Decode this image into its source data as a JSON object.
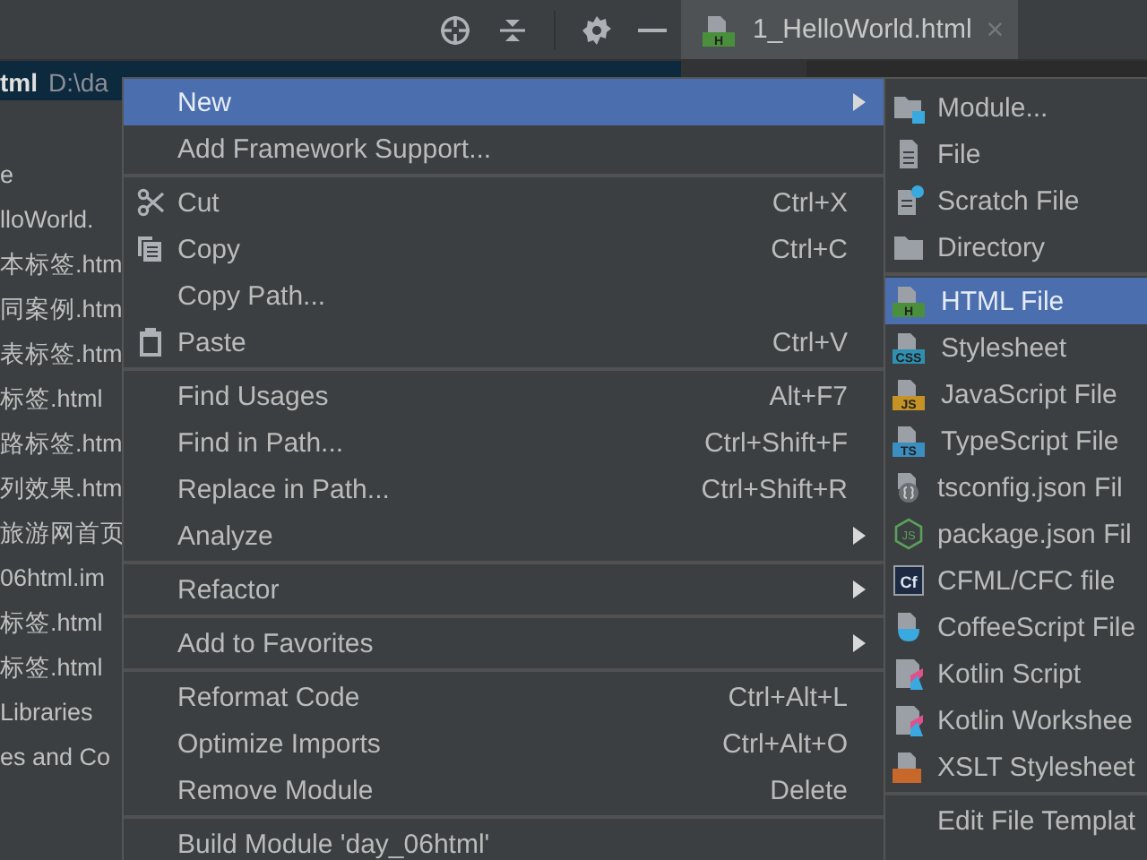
{
  "project_panel": {
    "header": {
      "name": "tml",
      "path": "D:\\da"
    },
    "items": [
      {
        "label": "e"
      },
      {
        "label": "lloWorld."
      },
      {
        "label": "本标签.htm"
      },
      {
        "label": "同案例.htm"
      },
      {
        "label": "表标签.htm"
      },
      {
        "label": "标签.html"
      },
      {
        "label": "路标签.htm"
      },
      {
        "label": "列效果.htm"
      },
      {
        "label": "旅游网首页"
      },
      {
        "label": "06html.im"
      },
      {
        "label": "标签.html"
      },
      {
        "label": "标签.html"
      },
      {
        "label": "Libraries"
      },
      {
        "label": "es and Co"
      }
    ]
  },
  "editor": {
    "tab": {
      "title": "1_HelloWorld.html",
      "badge": "H",
      "close": "×"
    }
  },
  "context_menu": {
    "items": [
      {
        "kind": "plain",
        "label": "New",
        "selected": true,
        "submenu": true
      },
      {
        "kind": "plain",
        "label": "Add Framework Support...",
        "selected": false
      },
      {
        "kind": "separator"
      },
      {
        "kind": "cut",
        "label": "Cut",
        "shortcut": "Ctrl+X",
        "selected": false
      },
      {
        "kind": "copy",
        "label": "Copy",
        "shortcut": "Ctrl+C",
        "selected": false
      },
      {
        "kind": "plain",
        "label": "Copy Path...",
        "selected": false
      },
      {
        "kind": "paste",
        "label": "Paste",
        "shortcut": "Ctrl+V",
        "selected": false
      },
      {
        "kind": "separator"
      },
      {
        "kind": "plain",
        "label": "Find Usages",
        "shortcut": "Alt+F7",
        "selected": false
      },
      {
        "kind": "plain",
        "label": "Find in Path...",
        "shortcut": "Ctrl+Shift+F",
        "selected": false
      },
      {
        "kind": "plain",
        "label": "Replace in Path...",
        "shortcut": "Ctrl+Shift+R",
        "selected": false
      },
      {
        "kind": "plain",
        "label": "Analyze",
        "selected": false,
        "submenu": true
      },
      {
        "kind": "separator"
      },
      {
        "kind": "plain",
        "label": "Refactor",
        "selected": false,
        "submenu": true
      },
      {
        "kind": "separator"
      },
      {
        "kind": "plain",
        "label": "Add to Favorites",
        "selected": false,
        "submenu": true
      },
      {
        "kind": "separator"
      },
      {
        "kind": "plain",
        "label": "Reformat Code",
        "shortcut": "Ctrl+Alt+L",
        "selected": false
      },
      {
        "kind": "plain",
        "label": "Optimize Imports",
        "shortcut": "Ctrl+Alt+O",
        "selected": false
      },
      {
        "kind": "plain",
        "label": "Remove Module",
        "shortcut": "Delete",
        "selected": false
      },
      {
        "kind": "separator"
      },
      {
        "kind": "plain",
        "label": "Build Module 'day_06html'",
        "selected": false
      }
    ]
  },
  "submenu": {
    "items": [
      {
        "kind": "module",
        "label": "Module...",
        "selected": false
      },
      {
        "kind": "file",
        "label": "File",
        "selected": false
      },
      {
        "kind": "scratch",
        "label": "Scratch File",
        "selected": false
      },
      {
        "kind": "folder",
        "label": "Directory",
        "selected": false
      },
      {
        "kind": "separator"
      },
      {
        "kind": "badge",
        "badge": "H",
        "color": "#4a8f3c",
        "label": "HTML File",
        "selected": true
      },
      {
        "kind": "badge",
        "badge": "CSS",
        "color": "#2f8fb0",
        "label": "Stylesheet",
        "selected": false
      },
      {
        "kind": "badge",
        "badge": "JS",
        "color": "#c59325",
        "label": "JavaScript File",
        "selected": false
      },
      {
        "kind": "badge",
        "badge": "TS",
        "color": "#3b8fc0",
        "label": "TypeScript File",
        "selected": false
      },
      {
        "kind": "braces",
        "label": "tsconfig.json Fil",
        "selected": false
      },
      {
        "kind": "hexagon",
        "badge": "JS",
        "label": "package.json Fil",
        "selected": false
      },
      {
        "kind": "square",
        "badge": "Cf",
        "label": "CFML/CFC file",
        "selected": false
      },
      {
        "kind": "cup",
        "label": "CoffeeScript File",
        "selected": false
      },
      {
        "kind": "kotlin",
        "label": "Kotlin Script",
        "selected": false
      },
      {
        "kind": "kotlin",
        "label": "Kotlin Workshee",
        "selected": false
      },
      {
        "kind": "xslt",
        "label": "XSLT Stylesheet",
        "selected": false
      },
      {
        "kind": "separator"
      },
      {
        "kind": "plain",
        "label": "Edit File Templat",
        "selected": false
      }
    ]
  }
}
